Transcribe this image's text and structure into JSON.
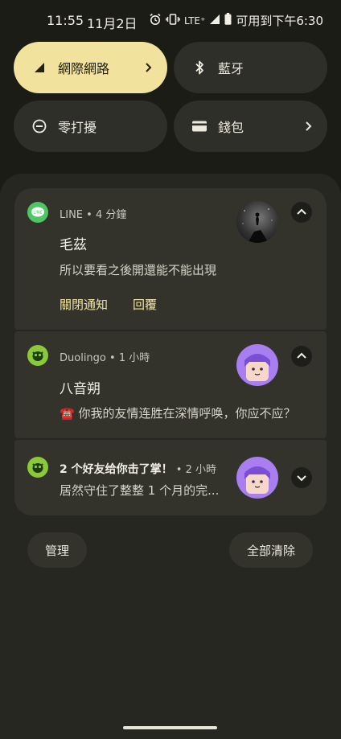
{
  "status_bar": {
    "time": "11:55",
    "date": "11月2日",
    "network": "LTE⁺",
    "battery_text": "可用到下午6:30",
    "icons": [
      "alarm-icon",
      "vibrate-icon",
      "signal-icon",
      "battery-icon"
    ]
  },
  "quick_settings": {
    "tiles": [
      {
        "label": "網際網路",
        "icon": "cellular-signal-icon",
        "active": true,
        "has_chevron": true
      },
      {
        "label": "藍牙",
        "icon": "bluetooth-icon",
        "active": false,
        "has_chevron": false
      },
      {
        "label": "零打擾",
        "icon": "do-not-disturb-icon",
        "active": false,
        "has_chevron": false
      },
      {
        "label": "錢包",
        "icon": "wallet-icon",
        "active": false,
        "has_chevron": true
      }
    ]
  },
  "notifications": [
    {
      "app": "LINE",
      "time": "4 分鐘",
      "title": "毛茲",
      "text": "所以要看之後開還能不能出現",
      "expanded": true,
      "actions": [
        "關閉通知",
        "回覆"
      ]
    },
    {
      "app": "Duolingo",
      "time": "1 小時",
      "title": "八音朔",
      "text": "☎️ 你我的友情连胜在深情呼唤，你应不应？",
      "expanded": true
    },
    {
      "app_title": "2 个好友给你击了掌！",
      "time": "2 小時",
      "text": "居然守住了整整 1 个月的完...",
      "expanded": false
    }
  ],
  "footer": {
    "manage_label": "管理",
    "clear_all_label": "全部清除"
  },
  "colors": {
    "accent": "#f1e39d",
    "line_green": "#4cc764",
    "duolingo_green": "#89c93a",
    "avatar_purple": "#a87ef0"
  }
}
